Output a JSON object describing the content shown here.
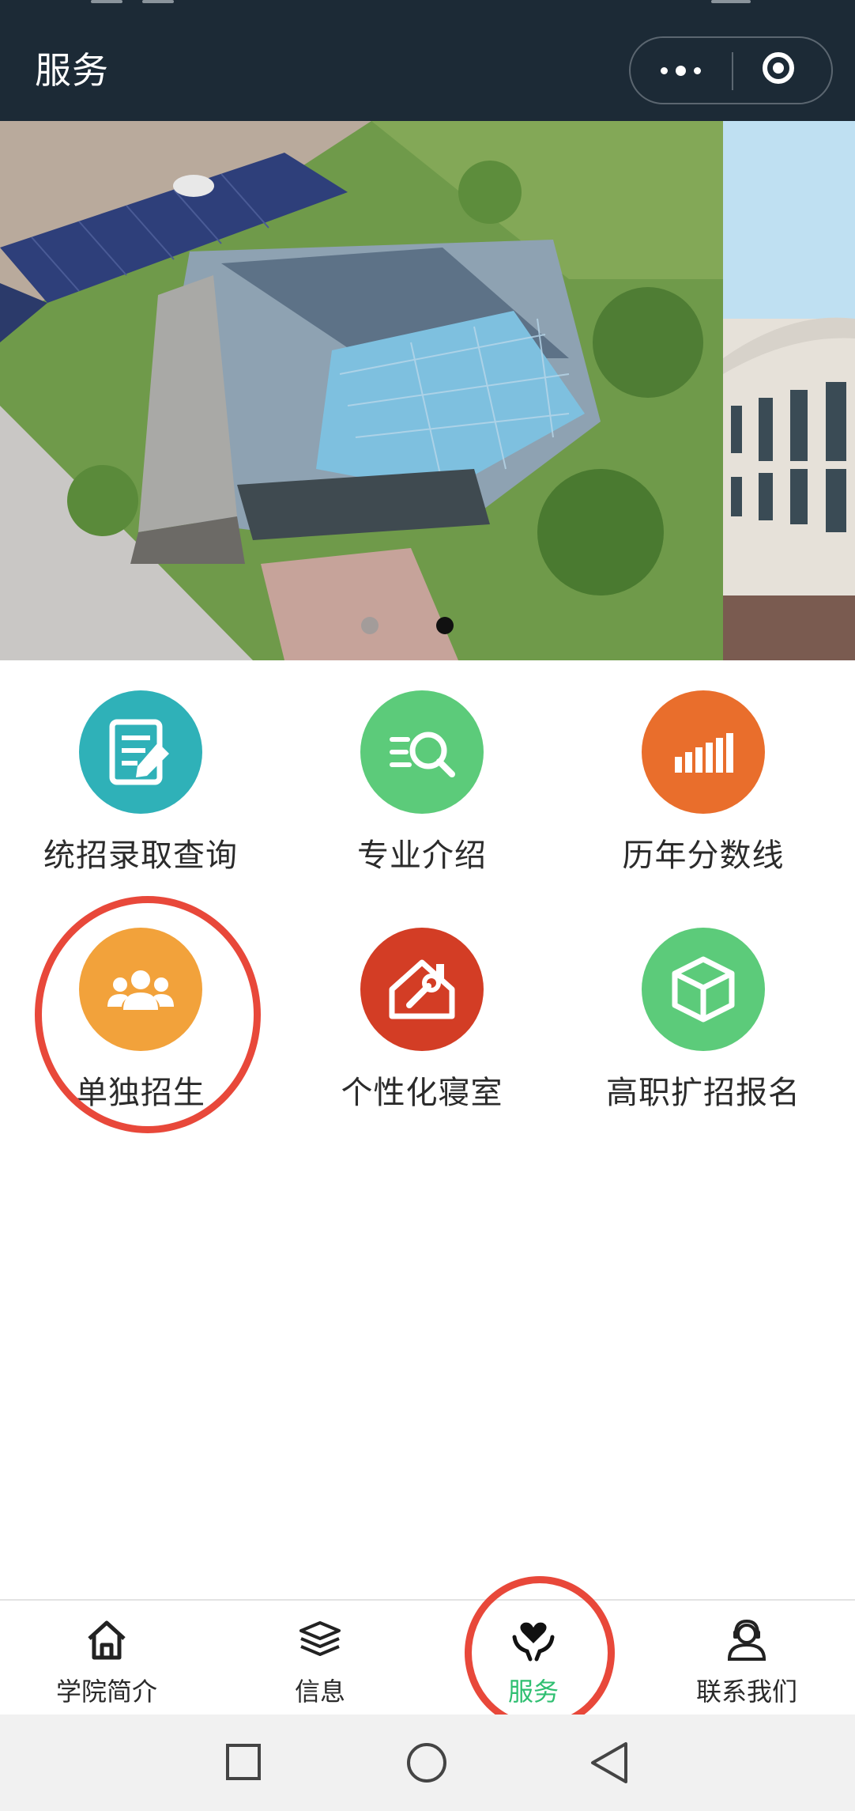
{
  "header": {
    "title": "服务",
    "more_icon": "more-dots-icon",
    "close_icon": "target-circle-icon"
  },
  "banner": {
    "slide_count": 3,
    "active_slide": 2
  },
  "services": [
    {
      "label": "统招录取查询",
      "icon": "document-edit-icon",
      "color": "#2fb1b8"
    },
    {
      "label": "专业介绍",
      "icon": "list-search-icon",
      "color": "#5ccb7a"
    },
    {
      "label": "历年分数线",
      "icon": "bar-chart-icon",
      "color": "#e96e2c"
    },
    {
      "label": "单独招生",
      "icon": "group-people-icon",
      "color": "#f2a23b"
    },
    {
      "label": "个性化寝室",
      "icon": "house-wrench-icon",
      "color": "#d33d25"
    },
    {
      "label": "高职扩招报名",
      "icon": "cube-icon",
      "color": "#5ccb7a"
    }
  ],
  "tabbar": {
    "items": [
      {
        "label": "学院简介",
        "icon": "home-icon"
      },
      {
        "label": "信息",
        "icon": "layers-icon"
      },
      {
        "label": "服务",
        "icon": "heart-hands-icon"
      },
      {
        "label": "联系我们",
        "icon": "headset-person-icon"
      }
    ],
    "active_index": 2,
    "active_color": "#2fbf71"
  },
  "system_nav": [
    "recent-apps-icon",
    "home-circle-icon",
    "back-triangle-icon"
  ]
}
